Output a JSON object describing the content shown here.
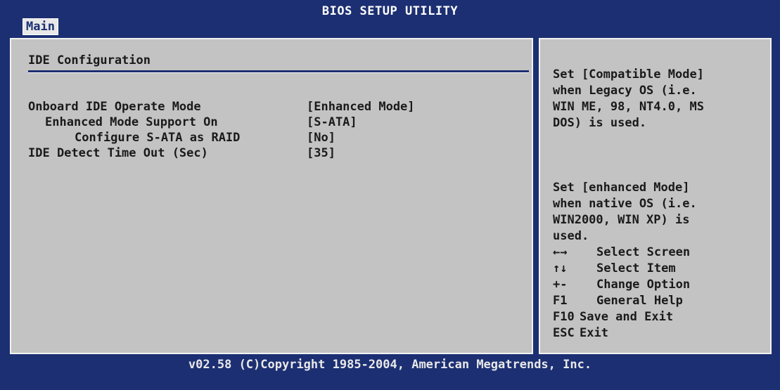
{
  "header": {
    "title": "BIOS SETUP UTILITY",
    "tab": "Main"
  },
  "section": {
    "title": "IDE Configuration"
  },
  "settings": [
    {
      "label": "Onboard IDE Operate Mode",
      "value": "[Enhanced Mode]"
    },
    {
      "label": "Enhanced Mode Support On",
      "value": "[S-ATA]"
    },
    {
      "label": "Configure S-ATA as RAID",
      "value": "[No]"
    },
    {
      "label": "IDE Detect Time Out (Sec)",
      "value": "[35]"
    }
  ],
  "help": {
    "paragraph1": "Set [Compatible Mode]\nwhen Legacy OS (i.e.\nWIN ME, 98, NT4.0, MS\nDOS) is used.",
    "paragraph2": "Set [enhanced Mode]\nwhen native OS (i.e.\nWIN2000, WIN XP) is\nused."
  },
  "keys": [
    {
      "key": "←→",
      "desc": "Select Screen"
    },
    {
      "key": "↑↓",
      "desc": "Select Item"
    },
    {
      "key": "+-",
      "desc": "Change Option"
    },
    {
      "key": "F1",
      "desc": "General Help"
    },
    {
      "key": "F10",
      "desc": "Save and Exit"
    },
    {
      "key": "ESC",
      "desc": "Exit"
    }
  ],
  "footer": {
    "copyright": "v02.58 (C)Copyright 1985-2004, American Megatrends, Inc."
  },
  "colors": {
    "background": "#1c2f72",
    "panel": "#c3c3c3",
    "text": "#1a1a1a",
    "header_text": "#ffffff"
  }
}
